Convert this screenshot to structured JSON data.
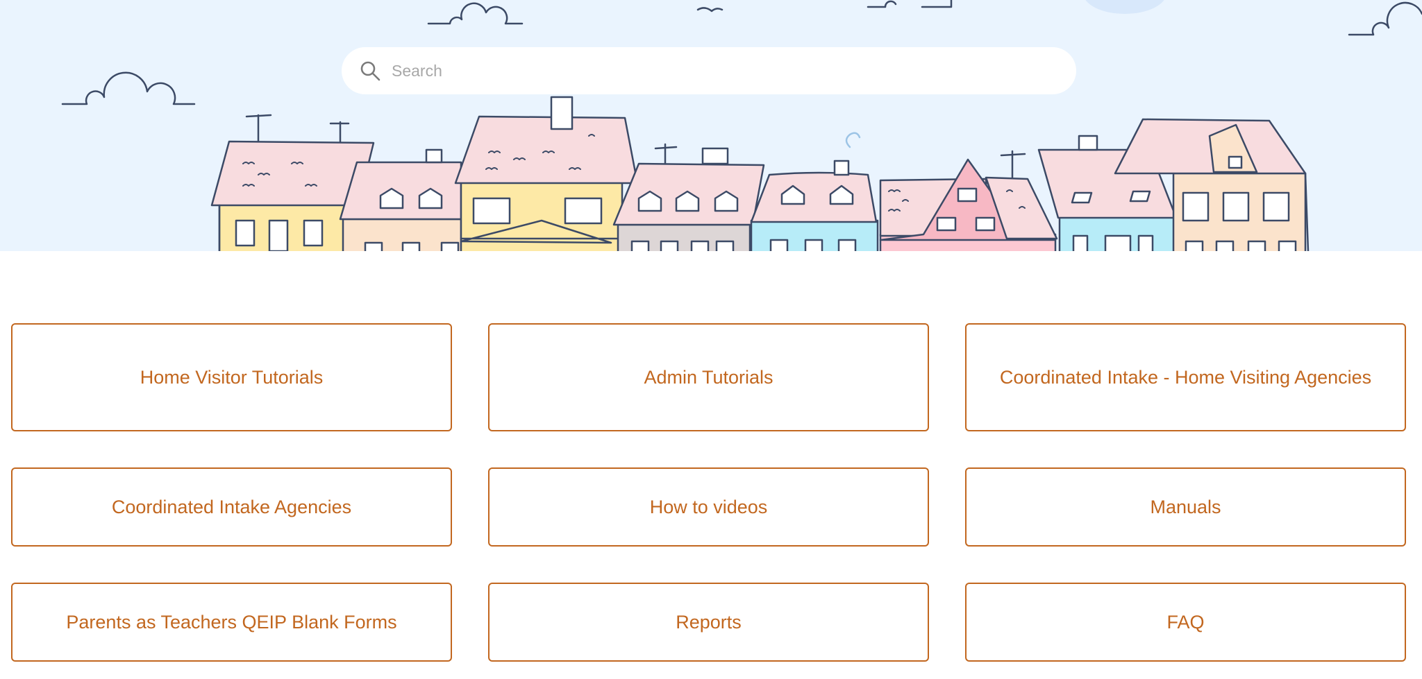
{
  "search": {
    "placeholder": "Search",
    "icon": "search-icon"
  },
  "categories": [
    {
      "label": "Home Visitor Tutorials"
    },
    {
      "label": "Admin Tutorials"
    },
    {
      "label": "Coordinated Intake - Home Visiting Agencies"
    },
    {
      "label": "Coordinated Intake Agencies"
    },
    {
      "label": "How to videos"
    },
    {
      "label": "Manuals"
    },
    {
      "label": "Parents as Teachers QEIP Blank Forms"
    },
    {
      "label": "Reports"
    },
    {
      "label": "FAQ"
    }
  ],
  "colors": {
    "hero_background": "#eaf4fe",
    "accent": "#c2671f",
    "line": "#3c4a66"
  }
}
